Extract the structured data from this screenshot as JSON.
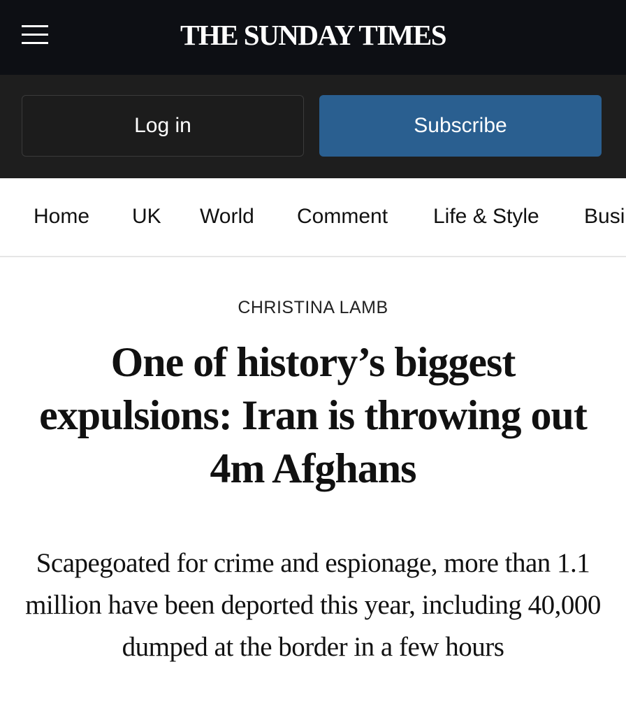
{
  "header": {
    "logo": "THE SUNDAY TIMES",
    "menu_icon": "hamburger-menu-icon"
  },
  "auth": {
    "login_label": "Log in",
    "subscribe_label": "Subscribe",
    "subscribe_color": "#2a5f90"
  },
  "nav": {
    "items": [
      "Home",
      "UK",
      "World",
      "Comment",
      "Life & Style",
      "Busi"
    ]
  },
  "article": {
    "byline": "CHRISTINA LAMB",
    "headline": "One of history’s biggest expulsions: Iran is throwing out 4m Afghans",
    "standfirst": "Scapegoated for crime and espionage, more than 1.1 million have been deported this year, including 40,000 dumped at the border in a few hours"
  }
}
